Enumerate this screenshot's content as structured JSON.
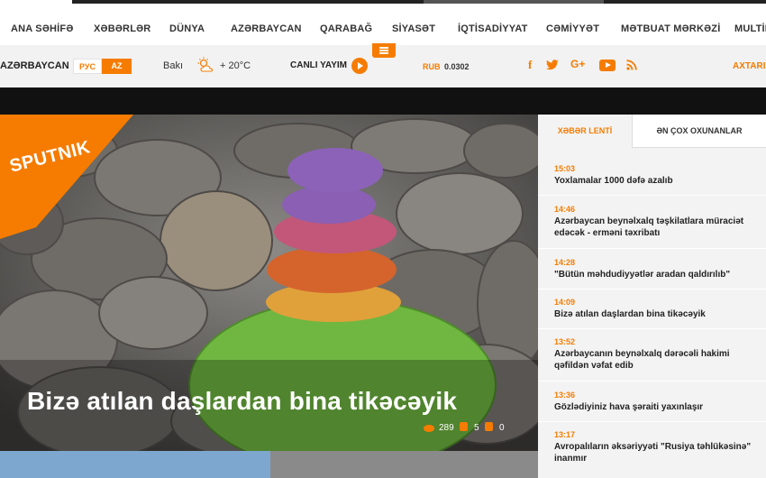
{
  "nav": {
    "items": [
      "ANA SƏHİFƏ",
      "XƏBƏRLƏR",
      "DÜNYA",
      "AZƏRBAYCAN",
      "QARABAĞ",
      "SİYASƏT",
      "İQTİSADİYYAT",
      "CƏMİYYƏT",
      "MƏTBUAT MƏRKƏZİ",
      "MULTİM"
    ]
  },
  "subbar": {
    "edition": "AZƏRBAYCAN",
    "lang_ru": "РУС",
    "lang_az": "AZ",
    "city": "Bakı",
    "temperature": "+ 20°C",
    "live_label": "CANLI YAYIM",
    "currency_label": "RUB",
    "currency_value": "0.0302",
    "search_label": "AXTARIŞ"
  },
  "hero": {
    "logo": "SPUTNIK",
    "title": "Bizə atılan daşlardan bina tikəcəyik",
    "views": "289",
    "likes": "5",
    "dislikes": "0"
  },
  "sidebar": {
    "tabs": [
      "XƏBƏR LENTİ",
      "ƏN ÇOX OXUNANLAR"
    ],
    "news": [
      {
        "time": "15:03",
        "title": "Yoxlamalar 1000 dəfə azalıb"
      },
      {
        "time": "14:46",
        "title": "Azərbaycan beynəlxalq təşkilatlara müraciət edəcək - erməni təxribatı"
      },
      {
        "time": "14:28",
        "title": "\"Bütün məhdudiyyətlər aradan qaldırılıb\""
      },
      {
        "time": "14:09",
        "title": "Bizə atılan daşlardan bina tikəcəyik"
      },
      {
        "time": "13:52",
        "title": "Azərbaycanın beynəlxalq dərəcəli hakimi qəfildən vəfat edib"
      },
      {
        "time": "13:36",
        "title": "Gözlədiyiniz hava şəraiti yaxınlaşır"
      },
      {
        "time": "13:17",
        "title": "Avropalıların əksəriyyəti \"Rusiya təhlükəsinə\" inanmır"
      }
    ]
  },
  "colors": {
    "accent": "#f57c00",
    "text": "#222222",
    "nav_bg": "#ffffff",
    "subbar_bg": "#f2f2f2"
  }
}
